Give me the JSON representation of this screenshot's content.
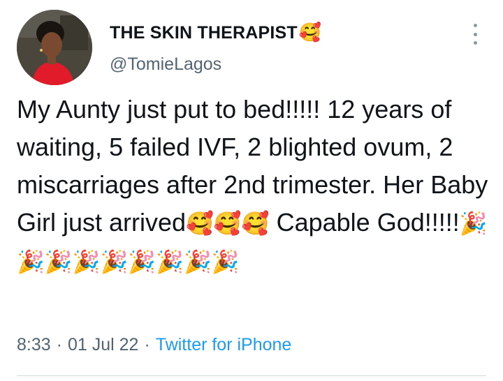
{
  "author": {
    "display_name": "THE SKIN THERAPIST",
    "name_emoji": "🥰",
    "handle": "@TomieLagos"
  },
  "tweet": {
    "text_part1": "My Aunty just put to bed!!!!! 12 years of waiting, 5 failed IVF, 2 blighted ovum, 2 miscarriages after 2nd trimester. Her Baby Girl just arrived",
    "emoji_love": "🥰🥰🥰",
    "text_part2": " Capable God!!!!!",
    "emoji_party": "🎉🎉🎉🎉🎉🎉🎉🎉🎉"
  },
  "meta": {
    "time": "8:33",
    "separator": "·",
    "date": "01 Jul 22",
    "source": "Twitter for iPhone"
  },
  "icons": {
    "more": "more-vertical-icon",
    "avatar": "profile-photo"
  },
  "colors": {
    "text": "#0f1419",
    "secondary": "#536471",
    "link": "#1d9bf0"
  }
}
